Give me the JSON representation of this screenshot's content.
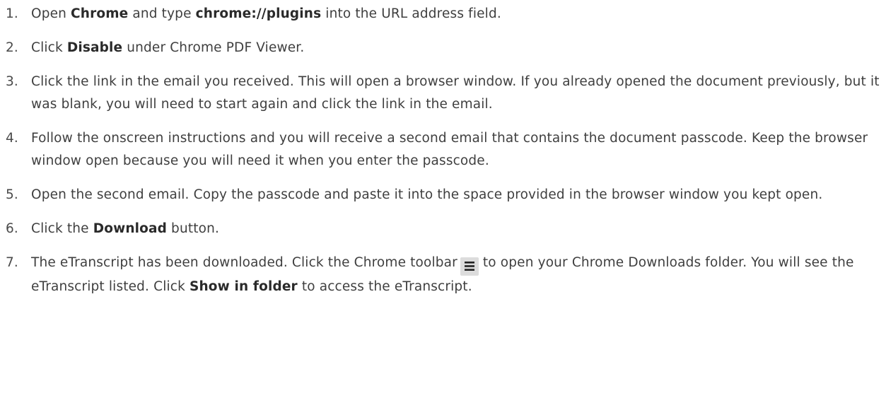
{
  "steps": [
    {
      "number": "1.",
      "parts": [
        {
          "text": "Open ",
          "bold": false
        },
        {
          "text": "Chrome",
          "bold": true
        },
        {
          "text": " and type ",
          "bold": false
        },
        {
          "text": "chrome://plugins",
          "bold": true
        },
        {
          "text": " into the URL address field.",
          "bold": false
        }
      ]
    },
    {
      "number": "2.",
      "parts": [
        {
          "text": "Click ",
          "bold": false
        },
        {
          "text": "Disable",
          "bold": true
        },
        {
          "text": " under Chrome PDF Viewer.",
          "bold": false
        }
      ]
    },
    {
      "number": "3.",
      "parts": [
        {
          "text": "Click the link in the email you received. This will open a browser window. If you already opened the document previously, but it was blank, you will need to start again and click the link in the email.",
          "bold": false
        }
      ]
    },
    {
      "number": "4.",
      "parts": [
        {
          "text": "Follow the onscreen instructions and you will receive a second email that contains the document passcode. Keep the browser window open because you will need it when you enter the passcode.",
          "bold": false
        }
      ]
    },
    {
      "number": "5.",
      "parts": [
        {
          "text": "Open the second email. Copy the passcode and paste it into the space provided in the browser window you kept open.",
          "bold": false
        }
      ]
    },
    {
      "number": "6.",
      "parts": [
        {
          "text": "Click the ",
          "bold": false
        },
        {
          "text": "Download",
          "bold": true
        },
        {
          "text": " button.",
          "bold": false
        }
      ]
    },
    {
      "number": "7.",
      "parts": [
        {
          "text": "The eTranscript has been downloaded. Click the Chrome toolbar",
          "bold": false
        },
        {
          "icon": "hamburger-menu-icon"
        },
        {
          "text": "to open your Chrome Downloads folder. You will see the eTranscript listed. Click ",
          "bold": false
        },
        {
          "text": "Show in folder",
          "bold": true
        },
        {
          "text": " to access the eTranscript.",
          "bold": false
        }
      ]
    }
  ],
  "colors": {
    "text": "#3f3f3f",
    "bold_text": "#2a2a2a",
    "icon_background": "#dcdcdc",
    "icon_glyph": "#222222"
  }
}
